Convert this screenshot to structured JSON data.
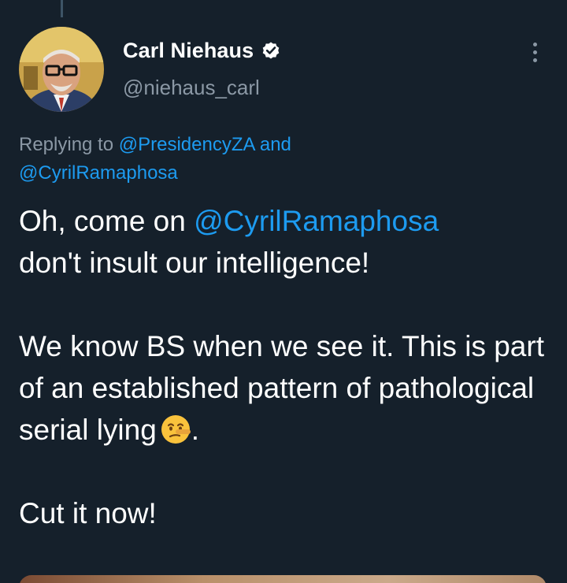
{
  "user": {
    "display_name": "Carl Niehaus",
    "handle": "@niehaus_carl",
    "verified": true
  },
  "reply_context": {
    "prefix": "Replying to",
    "mention_1": "@PresidencyZA",
    "joiner": "and",
    "mention_2": "@CyrilRamaphosa"
  },
  "tweet": {
    "line1_text": "Oh, come on ",
    "line1_mention": "@CyrilRamaphosa",
    "line2_text": "don't insult our intelligence!",
    "para2_text": "We know BS when we see it. This is part of an established pattern of pathological serial lying",
    "para2_emoji": "lying-face-emoji",
    "para2_end": ".",
    "para3_text": "Cut it now!"
  },
  "icons": {
    "verified": "verified-badge-icon",
    "more": "more-options-icon"
  },
  "colors": {
    "background": "#15202b",
    "link": "#1d9bf0",
    "secondary_text": "#8b98a5"
  }
}
